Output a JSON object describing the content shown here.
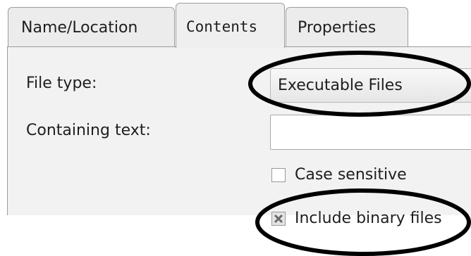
{
  "tabs": [
    {
      "label": "Name/Location",
      "active": false
    },
    {
      "label": "Contents",
      "active": true
    },
    {
      "label": "Properties",
      "active": false
    }
  ],
  "form": {
    "file_type_label": "File type:",
    "file_type_value": "Executable Files",
    "containing_text_label": "Containing text:",
    "containing_text_value": "",
    "case_sensitive_label": "Case sensitive",
    "case_sensitive_checked": false,
    "include_binary_label": "Include binary files",
    "include_binary_checked": true
  },
  "icons": [
    "check-x-icon"
  ],
  "colors": {
    "annotation": "#000000",
    "panel": "#f2f2f2",
    "tab": "#ececec"
  }
}
